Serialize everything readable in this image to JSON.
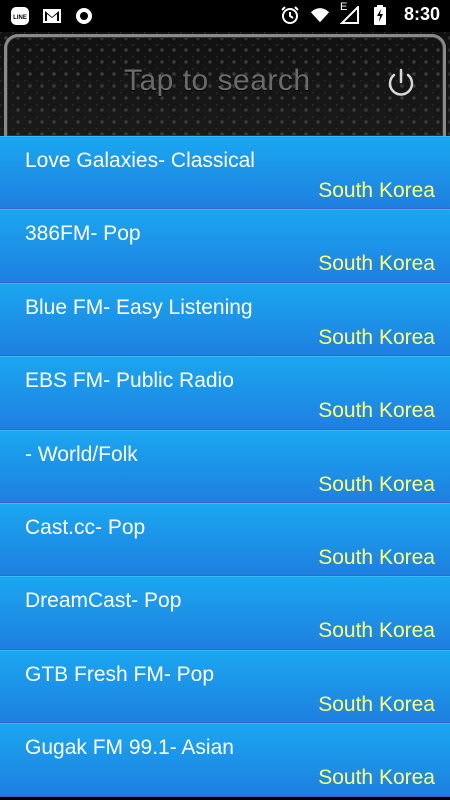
{
  "statusbar": {
    "time": "8:30",
    "network_letter": "E",
    "left_icons": [
      "line-app-icon",
      "gmail-icon",
      "record-icon"
    ],
    "right_icons": [
      "alarm-icon",
      "wifi-icon",
      "signal-icon",
      "battery-charging-icon"
    ]
  },
  "header": {
    "search_placeholder": "Tap to search",
    "power_icon": "power-icon"
  },
  "stations": [
    {
      "title": "Love Galaxies- Classical",
      "country": "South Korea"
    },
    {
      "title": "386FM- Pop",
      "country": "South Korea"
    },
    {
      "title": "Blue FM- Easy Listening",
      "country": "South Korea"
    },
    {
      "title": "EBS FM- Public Radio",
      "country": "South Korea"
    },
    {
      "title": "- World/Folk",
      "country": "South Korea"
    },
    {
      "title": "Cast.cc- Pop",
      "country": "South Korea"
    },
    {
      "title": "DreamCast- Pop",
      "country": "South Korea"
    },
    {
      "title": "GTB Fresh FM- Pop",
      "country": "South Korea"
    },
    {
      "title": "Gugak FM 99.1- Asian",
      "country": "South Korea"
    }
  ],
  "colors": {
    "list_top": "#1aa7f0",
    "list_bottom": "#1f7fe0",
    "country_text": "#ffff7a"
  }
}
